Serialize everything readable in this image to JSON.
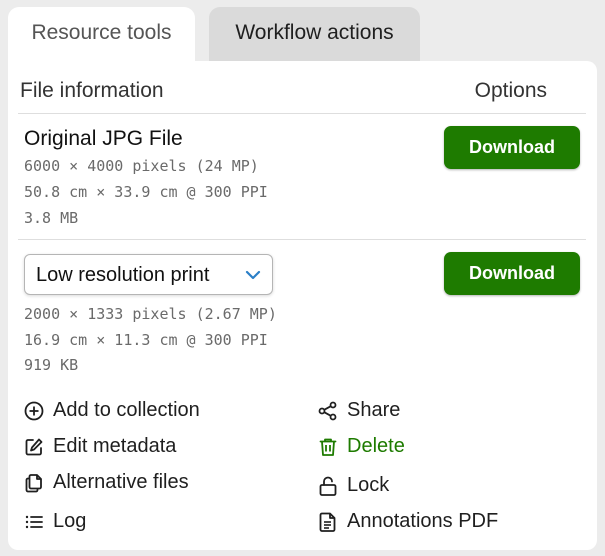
{
  "tabs": [
    {
      "label": "Resource tools"
    },
    {
      "label": "Workflow actions"
    }
  ],
  "table": {
    "file_header": "File information",
    "options_header": "Options"
  },
  "original": {
    "title": "Original JPG File",
    "pixels": "6000 × 4000 pixels (24 MP)",
    "dimensions": "50.8 cm × 33.9 cm @ 300 PPI",
    "size": "3.8 MB",
    "download_label": "Download"
  },
  "variant": {
    "selected": "Low resolution print",
    "pixels": "2000 × 1333 pixels (2.67 MP)",
    "dimensions": "16.9 cm × 11.3 cm @ 300 PPI",
    "size": "919 KB",
    "download_label": "Download"
  },
  "actions": {
    "add_to_collection": {
      "label": "Add to collection",
      "icon": "plus-circle-icon"
    },
    "edit_metadata": {
      "label": "Edit metadata",
      "icon": "edit-icon"
    },
    "alternative_files": {
      "label": "Alternative files",
      "icon": "files-icon"
    },
    "log": {
      "label": "Log",
      "icon": "list-icon"
    },
    "share": {
      "label": "Share",
      "icon": "share-icon"
    },
    "delete": {
      "label": "Delete",
      "icon": "trash-icon"
    },
    "lock": {
      "label": "Lock",
      "icon": "unlock-icon"
    },
    "annotations_pdf": {
      "label": "Annotations PDF",
      "icon": "document-icon"
    }
  },
  "colors": {
    "accent_green": "#1e7b00",
    "chevron_blue": "#2b7fc7"
  }
}
